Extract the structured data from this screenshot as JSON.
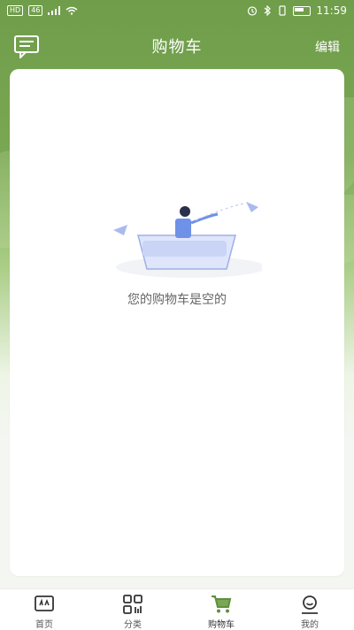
{
  "status_bar": {
    "left_chips": [
      "HD",
      "46"
    ],
    "time": "11:59"
  },
  "header": {
    "title": "购物车",
    "edit_label": "编辑",
    "message_icon": "message-icon"
  },
  "cart": {
    "empty_message": "您的购物车是空的",
    "illustration_icon": "empty-cart-illustration"
  },
  "tabbar": {
    "items": [
      {
        "label": "首页",
        "icon": "home-icon",
        "active": false
      },
      {
        "label": "分类",
        "icon": "category-icon",
        "active": false
      },
      {
        "label": "购物车",
        "icon": "cart-icon",
        "active": true
      },
      {
        "label": "我的",
        "icon": "profile-icon",
        "active": false
      }
    ]
  },
  "colors": {
    "brand_green": "#6f9d4a",
    "active_tab": "#5f8f3c"
  }
}
